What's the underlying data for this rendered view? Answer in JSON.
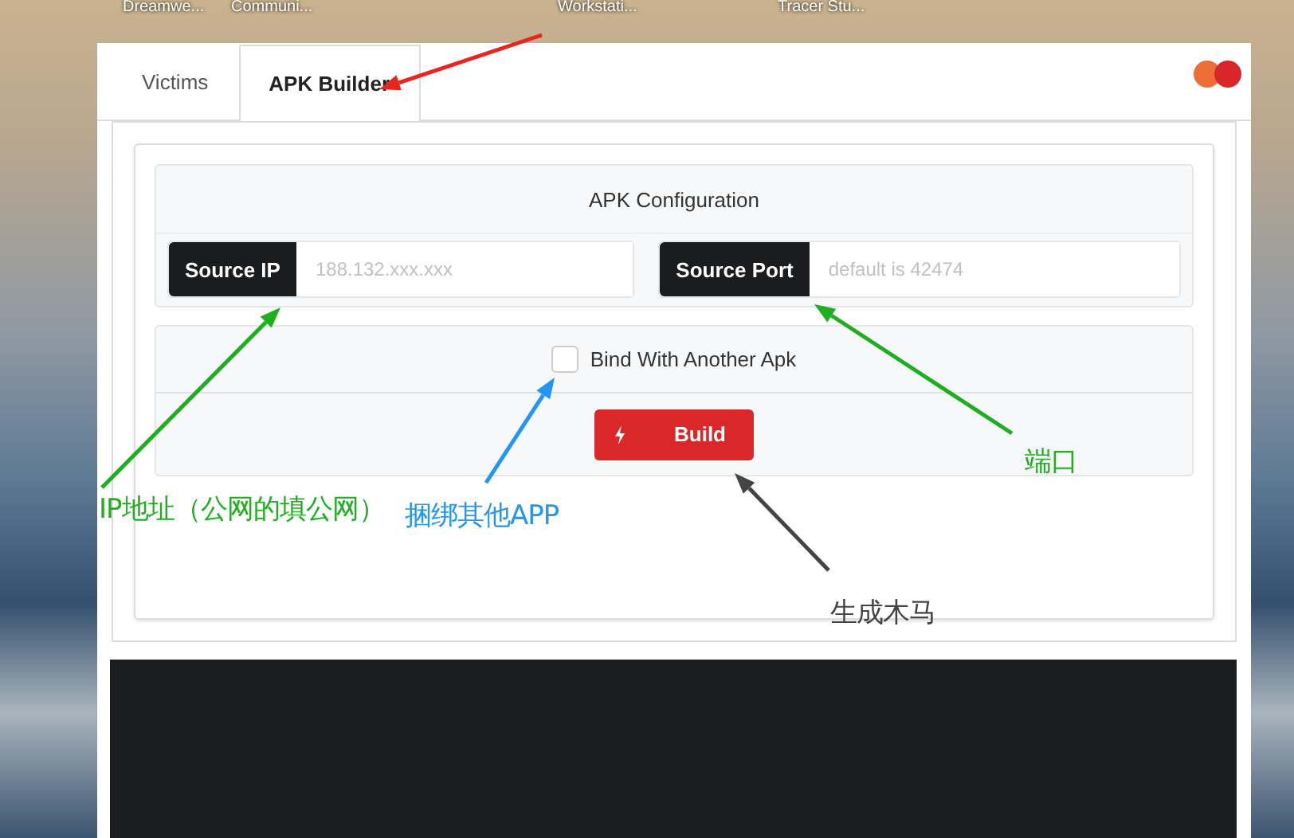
{
  "desktop_icons": [
    {
      "label": "Dreamwe..."
    },
    {
      "label": "Communi..."
    },
    {
      "label": "Workstati..."
    },
    {
      "label": "Tracer Stu..."
    }
  ],
  "window": {
    "tabs": [
      {
        "label": "Victims",
        "selected": false
      },
      {
        "label": "APK Builder",
        "selected": true
      }
    ],
    "config": {
      "title": "APK Configuration",
      "fields": [
        {
          "label": "Source IP",
          "placeholder": "188.132.xxx.xxx"
        },
        {
          "label": "Source Port",
          "placeholder": "default is 42474"
        }
      ]
    },
    "bind": {
      "label": "Bind With Another Apk",
      "checked": false
    },
    "build_button": {
      "label": "Build"
    }
  },
  "annotations": [
    {
      "text": "IP地址（公网的填公网）",
      "color": "#1fae1f"
    },
    {
      "text": "捆绑其他APP",
      "color": "#2196f3"
    },
    {
      "text": "端口",
      "color": "#1fae1f"
    },
    {
      "text": "生成木马",
      "color": "#444444"
    }
  ]
}
